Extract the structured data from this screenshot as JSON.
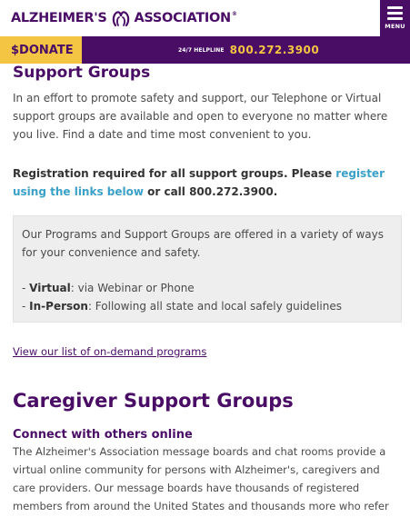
{
  "header": {
    "logo_left": "ALZHEIMER'S",
    "logo_right": "ASSOCIATION",
    "logo_tm": "®",
    "menu_label": "MENU"
  },
  "topbar": {
    "donate_symbol": "$",
    "donate_label": "DONATE",
    "helpline_label": "24/7 HELPLINE",
    "helpline_number": "800.272.3900"
  },
  "content": {
    "section_title": "Support Groups",
    "intro": "In an effort to promote safety and support, our Telephone or Virtual support groups are available and open to everyone no matter where you live. Find a date and time most convenient to you.",
    "registration_prefix": "Registration required for all support groups. Please ",
    "registration_link": "register using the links below",
    "registration_suffix": " or call 800.272.3900.",
    "callout_text": "Our Programs and Support Groups are offered in a variety of ways for your convenience and safety.",
    "callout_items": [
      {
        "label": "Virtual",
        "text": ": via Webinar or Phone"
      },
      {
        "label": "In-Person",
        "text": ": Following all state and local safely guidelines"
      }
    ],
    "ondemand_link": "View our list of on-demand programs",
    "caregiver_title": "Caregiver Support Groups",
    "connect_title": "Connect with others online",
    "connect_text": "The Alzheimer's Association message boards and chat rooms provide a virtual online community for persons with Alzheimer's, caregivers and care providers. Our message boards have thousands of registered members from around the United States and thousands more who refer to the stories and information"
  },
  "colors": {
    "brand_purple": "#4a0d66",
    "donate_yellow": "#f4c542",
    "link_blue": "#3aa0c8"
  }
}
